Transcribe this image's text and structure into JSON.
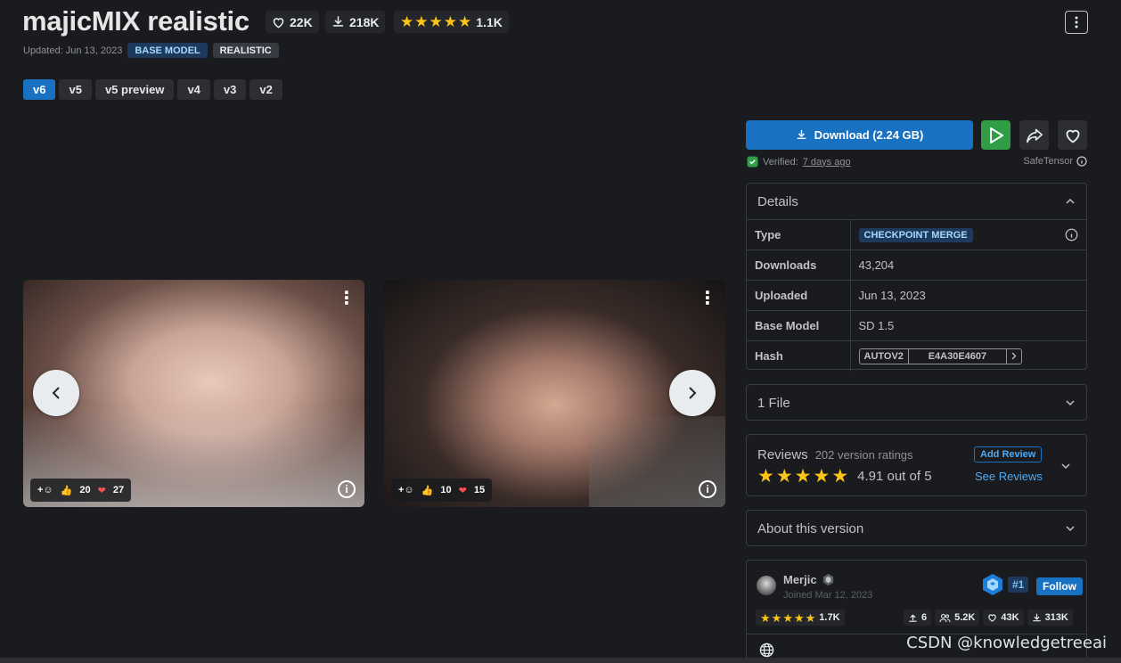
{
  "header": {
    "title": "majicMIX realistic",
    "likes": "22K",
    "downloads": "218K",
    "rating_count": "1.1K",
    "updated": "Updated: Jun 13, 2023",
    "badges": [
      "BASE MODEL",
      "REALISTIC"
    ]
  },
  "version_tabs": [
    "v6",
    "v5",
    "v5 preview",
    "v4",
    "v3",
    "v2"
  ],
  "active_version": "v6",
  "gallery": [
    {
      "likes": "20",
      "hearts": "27"
    },
    {
      "likes": "10",
      "hearts": "15"
    }
  ],
  "sidebar": {
    "download_label": "Download (2.24 GB)",
    "verified_label": "Verified:",
    "verified_when": "7 days ago",
    "format": "SafeTensor",
    "details_title": "Details",
    "details": [
      {
        "key": "Type",
        "value": "CHECKPOINT MERGE"
      },
      {
        "key": "Downloads",
        "value": "43,204"
      },
      {
        "key": "Uploaded",
        "value": "Jun 13, 2023"
      },
      {
        "key": "Base Model",
        "value": "SD 1.5"
      },
      {
        "key": "Hash",
        "value": ""
      }
    ],
    "hash_type": "AUTOV2",
    "hash_value": "E4A30E4607",
    "files_title": "1 File",
    "reviews_title": "Reviews",
    "reviews_count": "202 version ratings",
    "reviews_score": "4.91 out of 5",
    "add_review": "Add Review",
    "see_reviews": "See Reviews",
    "about_title": "About this version"
  },
  "creator": {
    "name": "Merjic",
    "joined": "Joined Mar 12, 2023",
    "rank": "#1",
    "follow": "Follow",
    "rating_count": "1.7K",
    "uploads": "6",
    "followers": "5.2K",
    "likes": "43K",
    "downloads": "313K"
  },
  "watermark": "CSDN @knowledgetreeai",
  "colors": {
    "accent": "#1971c2",
    "star": "#fcc419",
    "play": "#2f9e44",
    "background": "#1a1b1e"
  }
}
